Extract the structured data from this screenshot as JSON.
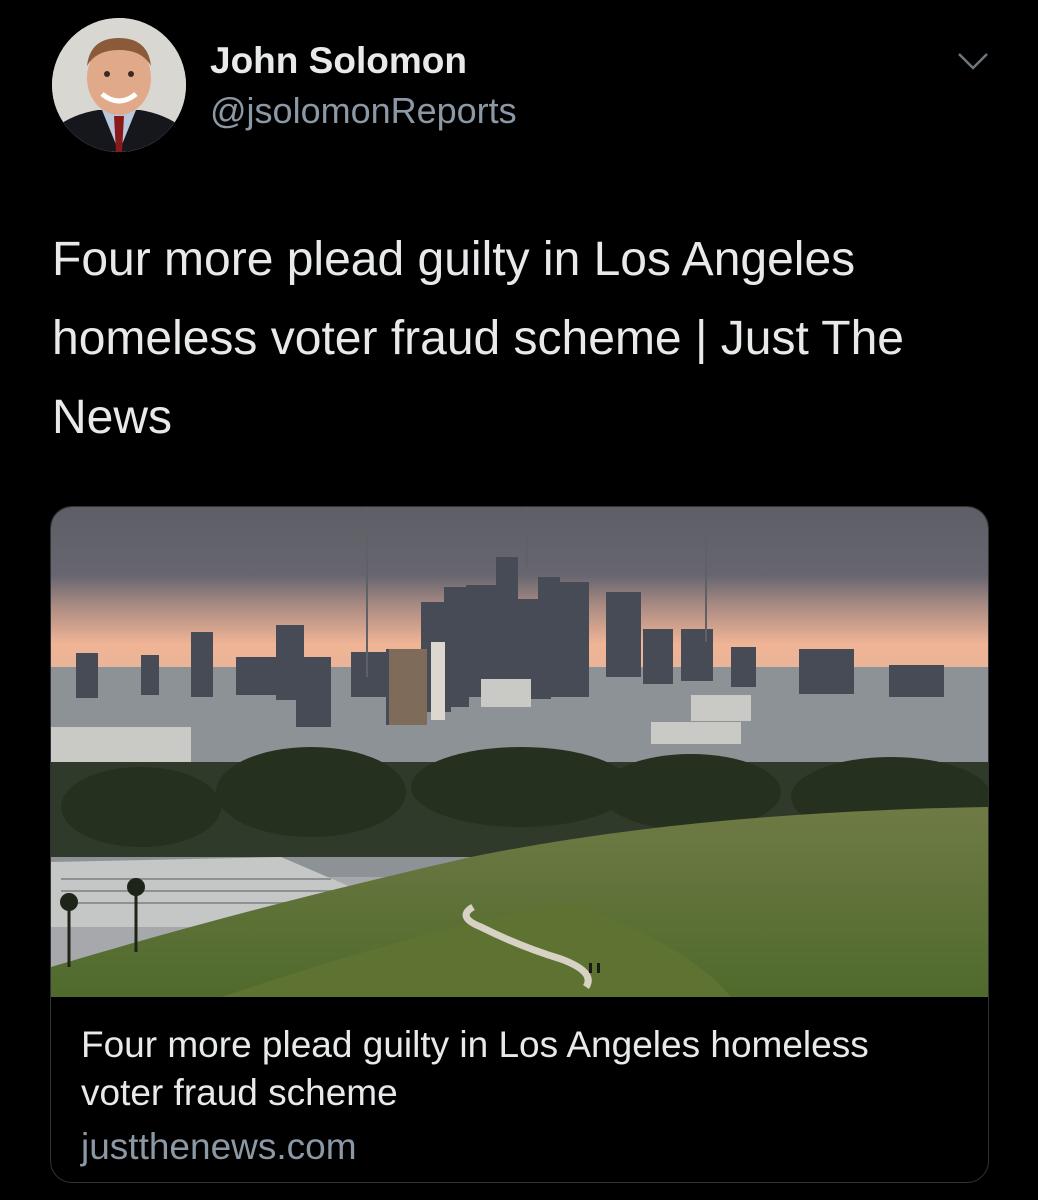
{
  "author": {
    "name": "John Solomon",
    "handle": "@jsolomonReports",
    "avatar_icon": "profile-photo-icon"
  },
  "menu_icon": "chevron-down-icon",
  "tweet": {
    "text": "Four more plead guilty in Los Angeles homeless voter fraud scheme | Just The News"
  },
  "link_card": {
    "image_icon": "los-angeles-skyline-photo",
    "title": "Four more plead guilty in Los Angeles homeless voter fraud scheme",
    "domain": "justthenews.com"
  },
  "colors": {
    "background": "#000000",
    "text": "#e7e9ea",
    "secondary_text": "#8b98a5",
    "border": "#2f3336"
  }
}
